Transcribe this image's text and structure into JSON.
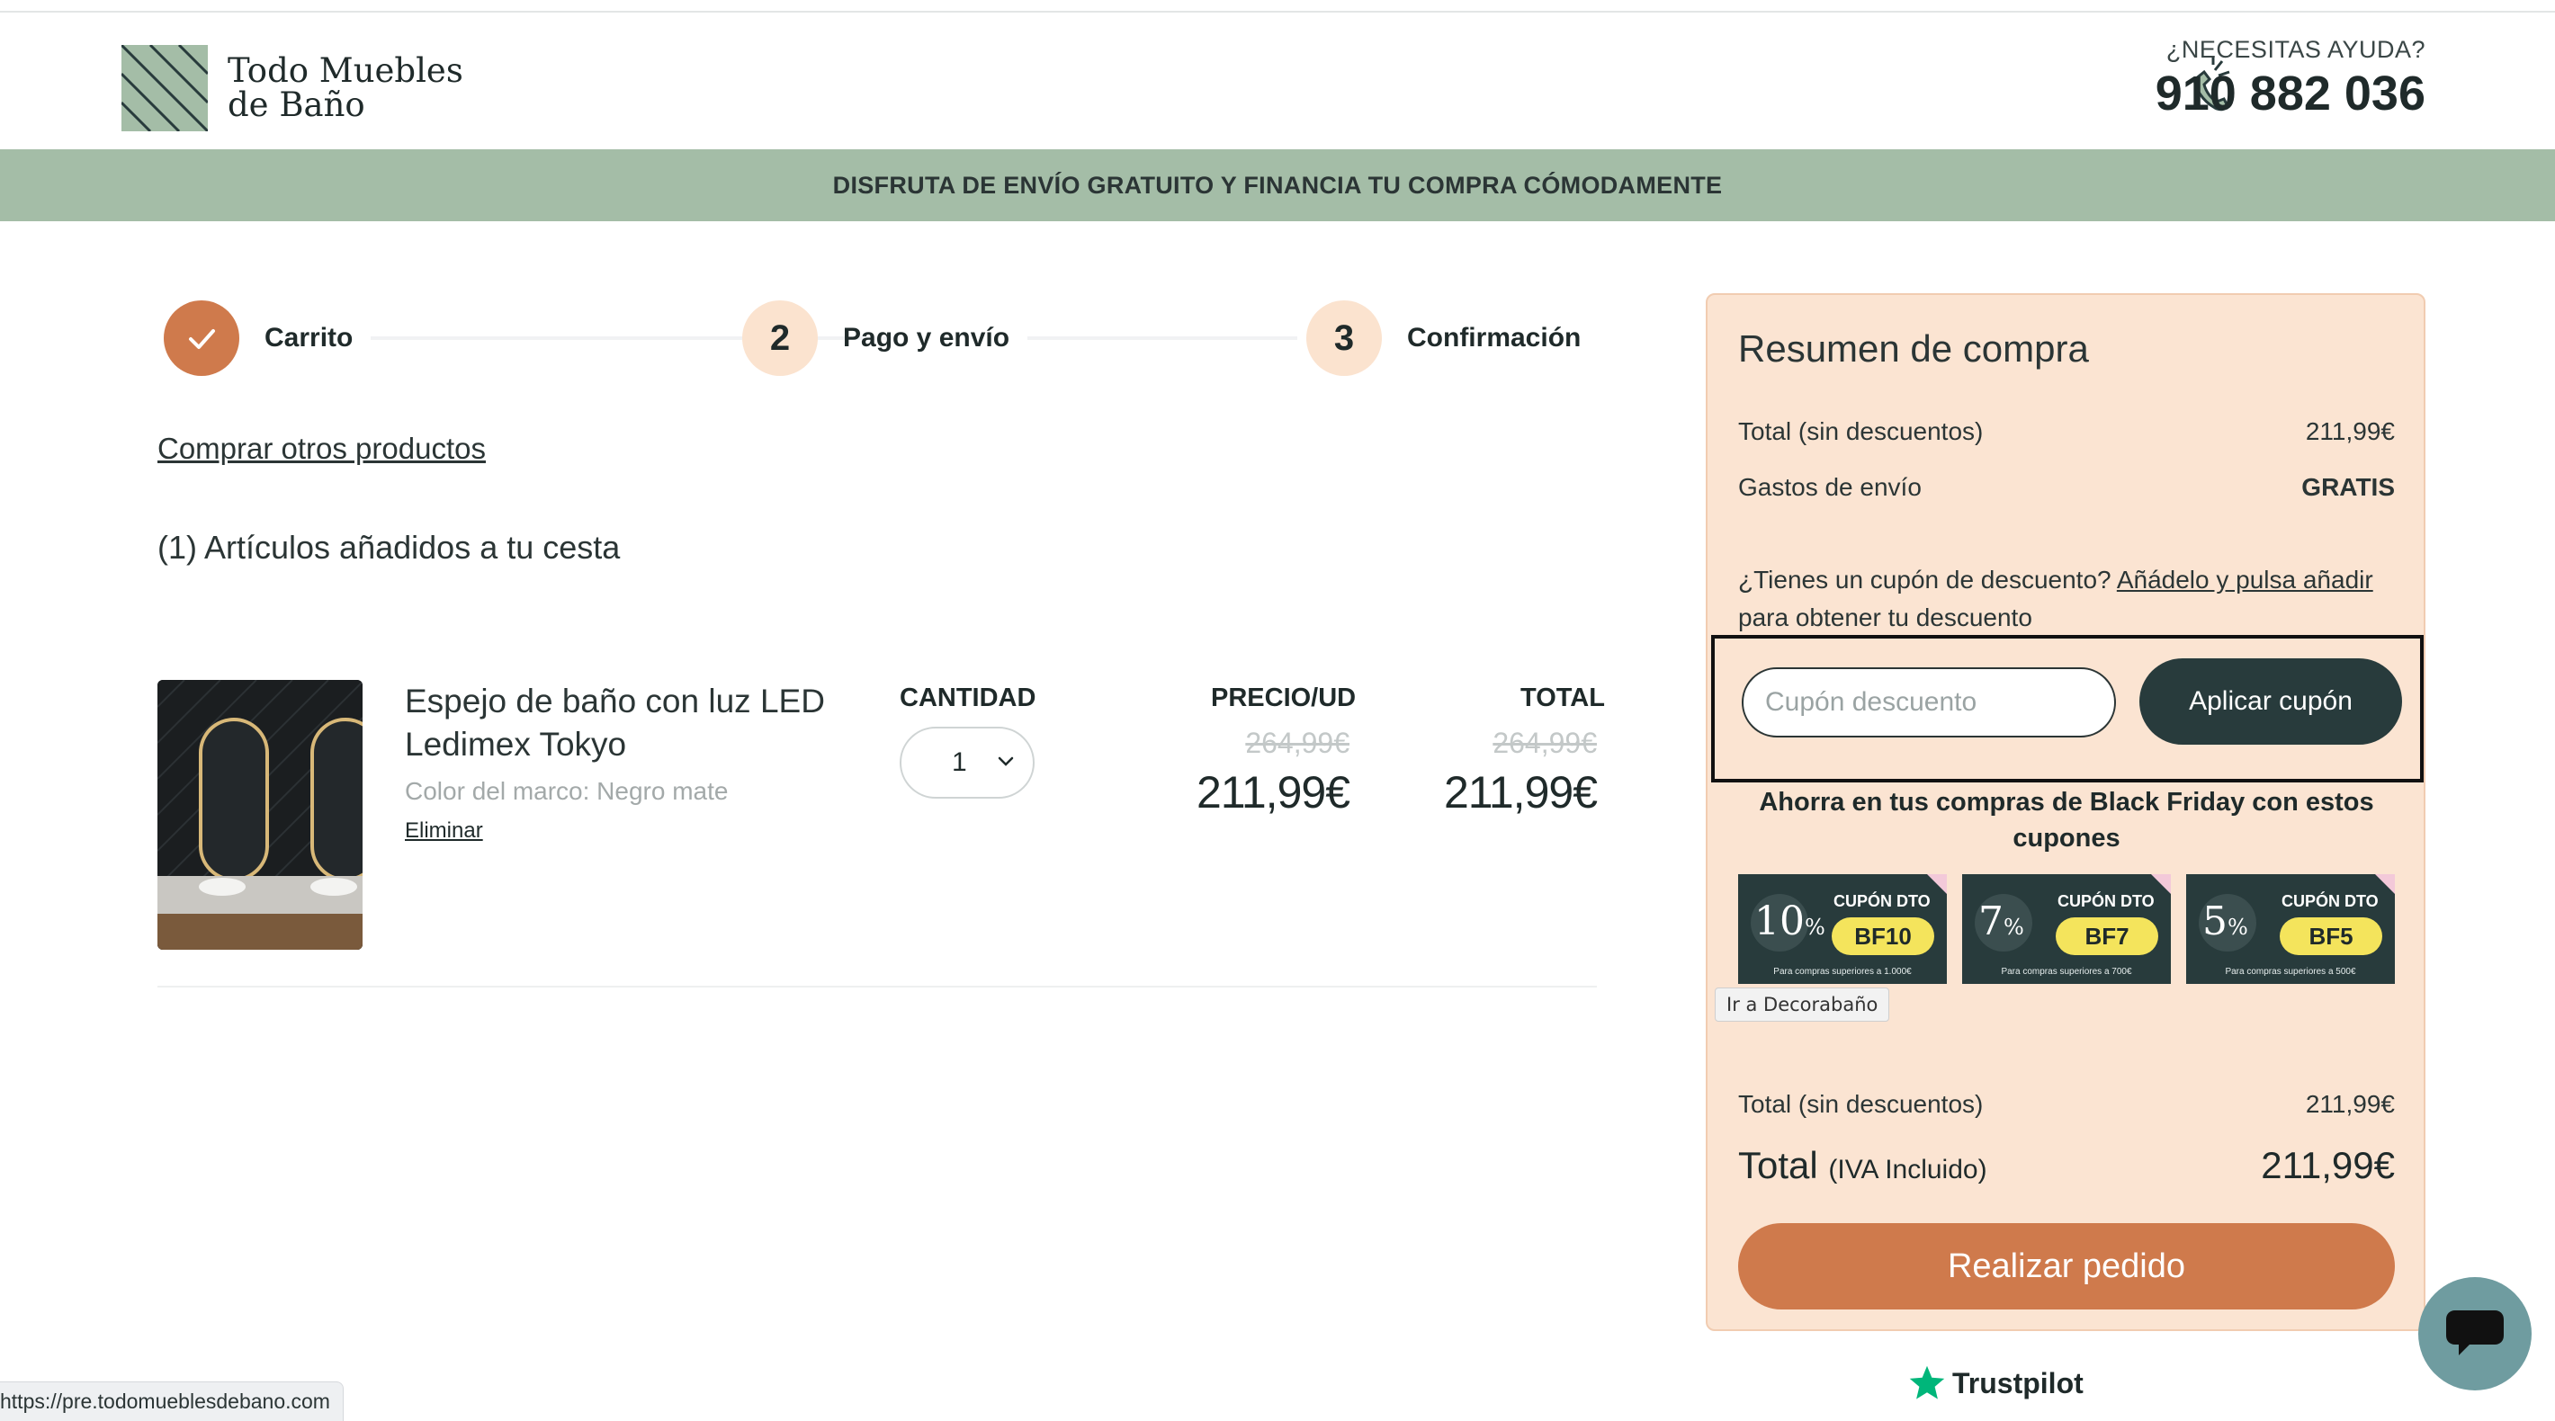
{
  "header": {
    "brand_line1": "Todo Muebles",
    "brand_line2": "de Baño",
    "help_label": "¿NECESITAS AYUDA?",
    "phone": "910 882 036",
    "colors": {
      "green": "#a4bda7",
      "dark": "#283b3c",
      "accent": "#cf7a4c",
      "peach": "#fbe4d2"
    }
  },
  "banner": {
    "text": "DISFRUTA DE ENVÍO GRATUITO Y FINANCIA TU COMPRA CÓMODAMENTE"
  },
  "steps": [
    {
      "label": "Carrito",
      "icon": "check-icon",
      "state": "done"
    },
    {
      "number": "2",
      "label": "Pago y envío",
      "state": "pending"
    },
    {
      "number": "3",
      "label": "Confirmación",
      "state": "pending"
    }
  ],
  "cart": {
    "other_products_link": "Comprar otros productos",
    "items_count_text": "(1) Artículos añadidos a tu cesta",
    "columns": {
      "quantity": "CANTIDAD",
      "unit_price": "PRECIO/UD",
      "total": "TOTAL"
    },
    "items": [
      {
        "name": "Espejo de baño con luz LED Ledimex Tokyo",
        "variant": "Color del marco: Negro mate",
        "remove_label": "Eliminar",
        "quantity": "1",
        "unit_price_old": "264,99€",
        "unit_price": "211,99€",
        "total_old": "264,99€",
        "total": "211,99€"
      }
    ]
  },
  "summary": {
    "title": "Resumen de compra",
    "subtotal_label": "Total (sin descuentos)",
    "subtotal_value": "211,99€",
    "shipping_label": "Gastos de envío",
    "shipping_value": "GRATIS",
    "coupon_prompt": "¿Tienes un cupón de descuento? ",
    "coupon_link": "Añádelo y pulsa añadir",
    "coupon_suffix": " para obtener tu descuento",
    "coupon_placeholder": "Cupón descuento",
    "coupon_button": "Aplicar cupón",
    "blackfriday_text": "Ahorra en tus compras de Black Friday con estos cupones",
    "coupons": [
      {
        "percent": "10",
        "label": "CUPÓN DTO",
        "code": "BF10",
        "note": "Para compras superiores a 1.000€"
      },
      {
        "percent": "7",
        "label": "CUPÓN DTO",
        "code": "BF7",
        "note": "Para compras superiores a 700€"
      },
      {
        "percent": "5",
        "label": "CUPÓN DTO",
        "code": "BF5",
        "note": "Para compras superiores a 500€"
      }
    ],
    "percent_sign": "%",
    "tooltip": "Ir a Decorabaño",
    "total_nodisc_label": "Total (sin descuentos)",
    "total_nodisc_value": "211,99€",
    "total_label": "Total",
    "total_sub": "(IVA Incluido)",
    "total_value": "211,99€",
    "order_button": "Realizar pedido"
  },
  "footer": {
    "trustpilot": "Trustpilot"
  },
  "status_bar": {
    "url": "https://pre.todomueblesdebano.com"
  }
}
